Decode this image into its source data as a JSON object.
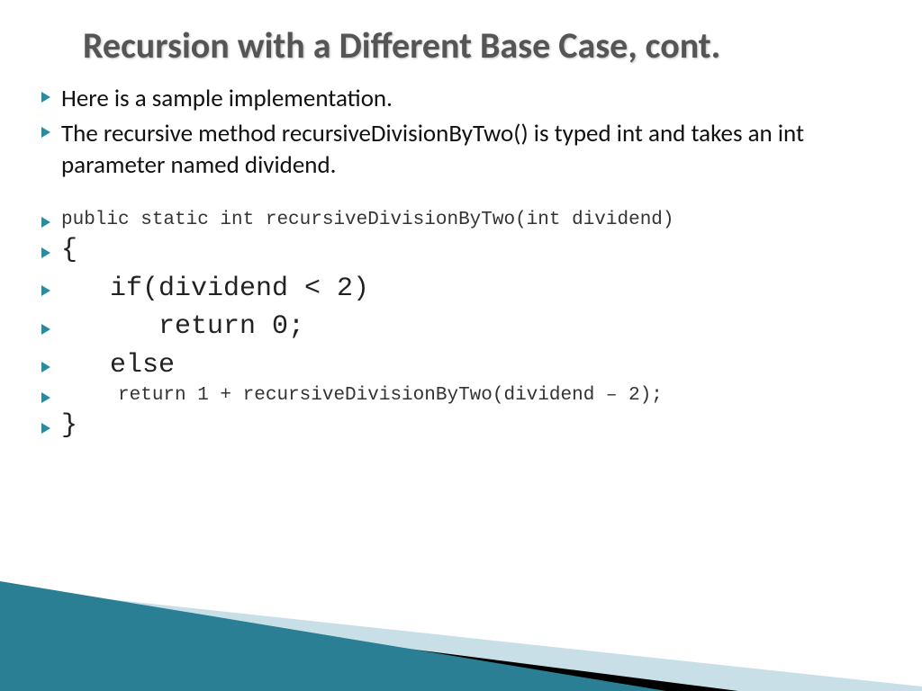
{
  "title": "Recursion with a Different Base Case, cont.",
  "bullets": [
    "Here is a sample implementation.",
    "The recursive method recursiveDivisionByTwo() is typed int and takes an int parameter named dividend."
  ],
  "code": [
    {
      "style": "small",
      "text": "public static int recursiveDivisionByTwo(int dividend)"
    },
    {
      "style": "large",
      "text": "{"
    },
    {
      "style": "large",
      "text": "   if(dividend < 2)"
    },
    {
      "style": "large",
      "text": "      return 0;"
    },
    {
      "style": "large",
      "text": "   else"
    },
    {
      "style": "small",
      "text": "     return 1 + recursiveDivisionByTwo(dividend – 2);"
    },
    {
      "style": "large",
      "text": "}"
    }
  ],
  "colors": {
    "bullet_arrow": "#2d8a9e",
    "decor_teal": "#2a7f95",
    "decor_light": "#c9dfe8",
    "decor_black": "#000000"
  }
}
